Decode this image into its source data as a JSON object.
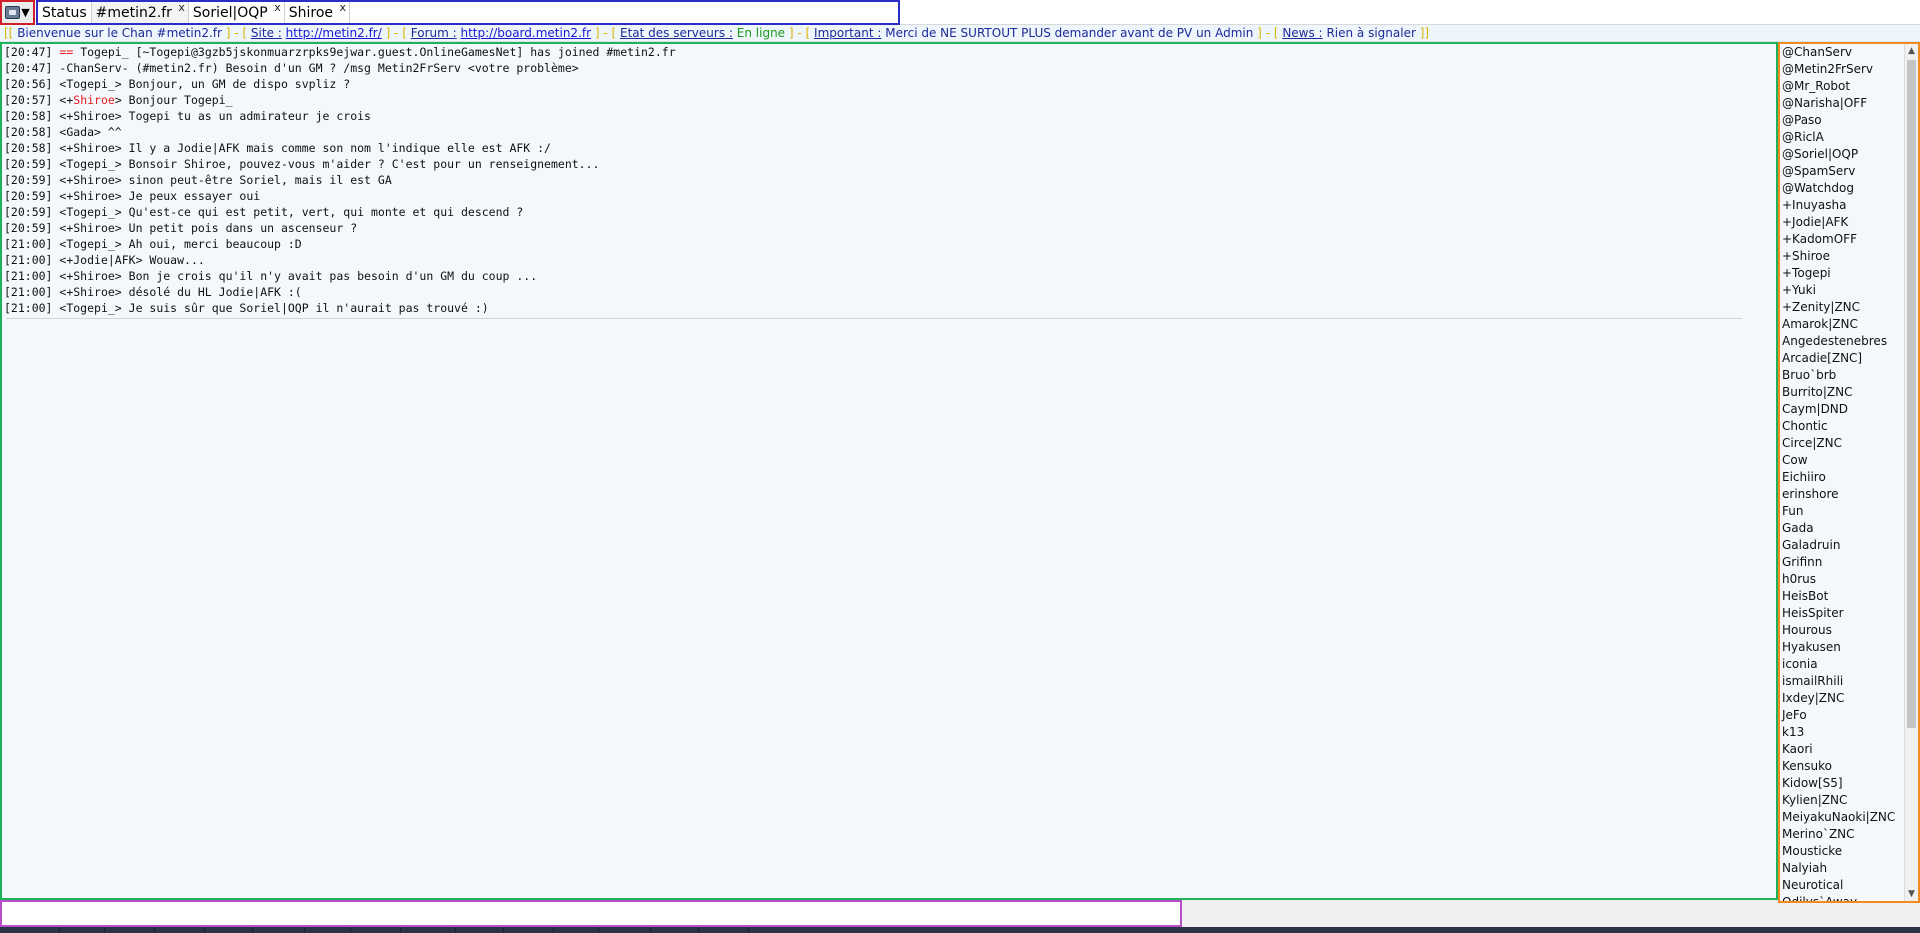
{
  "window": {
    "menu_button_icon": "app-menu-icon",
    "menu_caret_icon": "caret-down-icon"
  },
  "tabs": [
    {
      "label": "Status",
      "closable": false,
      "active": false
    },
    {
      "label": "#metin2.fr",
      "closable": true,
      "active": true
    },
    {
      "label": "Soriel|OQP",
      "closable": true,
      "active": false
    },
    {
      "label": "Shiroe",
      "closable": true,
      "active": false
    }
  ],
  "tab_close_glyph": "x",
  "topic": {
    "open_bracket": "[[",
    "welcome": "Bienvenue sur le Chan #metin2.fr",
    "site_label": "Site :",
    "site_url": "http://metin2.fr/",
    "forum_label": "Forum :",
    "forum_url": "http://board.metin2.fr",
    "servers_label": "Etat des serveurs :",
    "servers_value": "En ligne",
    "important_label": "Important :",
    "important_value": "Merci de NE SURTOUT PLUS demander avant de PV un Admin",
    "news_label": "News :",
    "news_value": "Rien à signaler",
    "close_bracket": "]]"
  },
  "messages": [
    {
      "time": "[20:47]",
      "pre": "",
      "red": "==",
      "post": " Togepi_ [~Togepi@3gzb5jskonmuarzrpks9ejwar.guest.OnlineGamesNet] has joined #metin2.fr"
    },
    {
      "time": "[20:47]",
      "pre": "-ChanServ- (#metin2.fr) Besoin d'un GM ? /msg Metin2FrServ <votre problème>",
      "red": "",
      "post": ""
    },
    {
      "time": "[20:56]",
      "pre": "<Togepi_> Bonjour, un GM de dispo svpliz ?",
      "red": "",
      "post": ""
    },
    {
      "time": "[20:57]",
      "pre": "<+",
      "red": "Shiroe",
      "post": "> Bonjour Togepi_"
    },
    {
      "time": "[20:58]",
      "pre": "<+Shiroe> Togepi tu as un admirateur je crois",
      "red": "",
      "post": ""
    },
    {
      "time": "[20:58]",
      "pre": "<Gada> ^^",
      "red": "",
      "post": ""
    },
    {
      "time": "[20:58]",
      "pre": "<+Shiroe> Il y a Jodie|AFK mais comme son nom l'indique elle est AFK :/",
      "red": "",
      "post": ""
    },
    {
      "time": "[20:59]",
      "pre": "<Togepi_> Bonsoir Shiroe, pouvez-vous m'aider ? C'est pour un renseignement...",
      "red": "",
      "post": ""
    },
    {
      "time": "[20:59]",
      "pre": "<+Shiroe> sinon peut-être Soriel, mais il est GA",
      "red": "",
      "post": ""
    },
    {
      "time": "[20:59]",
      "pre": "<+Shiroe> Je peux essayer oui",
      "red": "",
      "post": ""
    },
    {
      "time": "[20:59]",
      "pre": "<Togepi_> Qu'est-ce qui est petit, vert, qui monte et qui descend ?",
      "red": "",
      "post": ""
    },
    {
      "time": "[20:59]",
      "pre": "<+Shiroe> Un petit pois dans un ascenseur ?",
      "red": "",
      "post": ""
    },
    {
      "time": "[21:00]",
      "pre": "<Togepi_> Ah oui, merci beaucoup :D",
      "red": "",
      "post": ""
    },
    {
      "time": "[21:00]",
      "pre": "<+Jodie|AFK> Wouaw...",
      "red": "",
      "post": ""
    },
    {
      "time": "[21:00]",
      "pre": "<+Shiroe> Bon je crois qu'il n'y avait pas besoin d'un GM du coup ...",
      "red": "",
      "post": ""
    },
    {
      "time": "[21:00]",
      "pre": "<+Shiroe> désolé du HL Jodie|AFK :(",
      "red": "",
      "post": ""
    },
    {
      "time": "[21:00]",
      "pre": "<Togepi_> Je suis sûr que Soriel|OQP il n'aurait pas trouvé :)",
      "red": "",
      "post": ""
    }
  ],
  "nicklist": [
    "@ChanServ",
    "@Metin2FrServ",
    "@Mr_Robot",
    "@Narisha|OFF",
    "@Paso",
    "@RiclA",
    "@Soriel|OQP",
    "@SpamServ",
    "@Watchdog",
    "+Inuyasha",
    "+Jodie|AFK",
    "+KadomOFF",
    "+Shiroe",
    "+Togepi",
    "+Yuki",
    "+Zenity|ZNC",
    "Amarok|ZNC",
    "Angedestenebres",
    "Arcadie[ZNC]",
    "Bruo`brb",
    "Burrito|ZNC",
    "Caym|DND",
    "Chontic",
    "Circe|ZNC",
    "Cow",
    "Eichiiro",
    "erinshore",
    "Fun",
    "Gada",
    "Galadruin",
    "Grifinn",
    "h0rus",
    "HeisBot",
    "HeisSpiter",
    "Hourous",
    "Hyakusen",
    "iconia",
    "ismailRhili",
    "Ixdey|ZNC",
    "JeFo",
    "k13",
    "Kaori",
    "Kensuko",
    "Kidow[S5]",
    "Kylien|ZNC",
    "MeiyakuNaoki|ZNC",
    "Merino`ZNC",
    "Mousticke",
    "Nalyiah",
    "Neurotical",
    "Odilys`Away"
  ],
  "scrollbar": {
    "up_icon": "▲",
    "down_icon": "▼"
  },
  "input": {
    "value": "",
    "placeholder": ""
  },
  "colors": {
    "menu_border": "#d0202a",
    "tabs_border": "#2c2cc8",
    "chat_border": "#1eb25a",
    "nicklist_border": "#f28a1e",
    "input_border": "#b84fc9",
    "highlight": "#e8191a"
  }
}
